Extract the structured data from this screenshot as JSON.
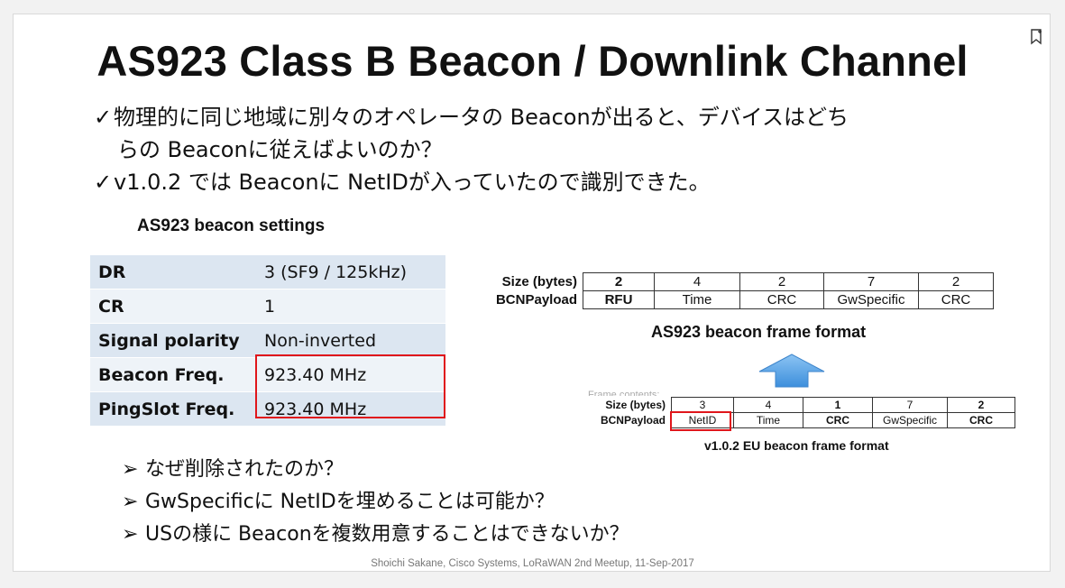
{
  "title": "AS923 Class B Beacon / Downlink Channel",
  "top_bullets": [
    {
      "line1": "物理的に同じ地域に別々のオペレータの Beaconが出ると、デバイスはどち",
      "line2": "らの Beaconに従えばよいのか？"
    },
    {
      "line1": "v1.0.2 では Beaconに NetIDが入っていたので識別できた。"
    }
  ],
  "check_glyph": "✓",
  "settings": {
    "caption": "AS923 beacon settings",
    "rows": [
      {
        "key": "DR",
        "value": "3  (SF9 / 125kHz)"
      },
      {
        "key": "CR",
        "value": "1"
      },
      {
        "key": "Signal polarity",
        "value": "Non-inverted"
      },
      {
        "key": "Beacon Freq.",
        "value": "923.40 MHz"
      },
      {
        "key": "PingSlot Freq.",
        "value": "923.40 MHz"
      }
    ]
  },
  "as923_frame": {
    "size_label": "Size (bytes)",
    "payload_label": "BCNPayload",
    "sizes": [
      "2",
      "4",
      "2",
      "7",
      "2"
    ],
    "fields": [
      "RFU",
      "Time",
      "CRC",
      "GwSpecific",
      "CRC"
    ],
    "caption": "AS923 beacon frame format"
  },
  "eu_frame": {
    "cutoff_text": "Frame contents:",
    "size_label": "Size (bytes)",
    "payload_label": "BCNPayload",
    "sizes": [
      "3",
      "4",
      "1",
      "7",
      "2"
    ],
    "fields": [
      "NetID",
      "Time",
      "CRC",
      "GwSpecific",
      "CRC"
    ],
    "caption": "v1.0.2 EU beacon frame format"
  },
  "bottom_bullets": [
    "なぜ削除されたのか？",
    "GwSpecificに NetIDを埋めることは可能か？",
    "USの様に Beaconを複数用意することはできないか？"
  ],
  "triangle_glyph": "➢",
  "footer": "Shoichi Sakane, Cisco Systems, LoRaWAN 2nd Meetup, 11-Sep-2017",
  "colors": {
    "row_dark": "#dce6f1",
    "row_light": "#eef3f8",
    "highlight": "#e0161b",
    "arrow": "#5aa5e8"
  }
}
